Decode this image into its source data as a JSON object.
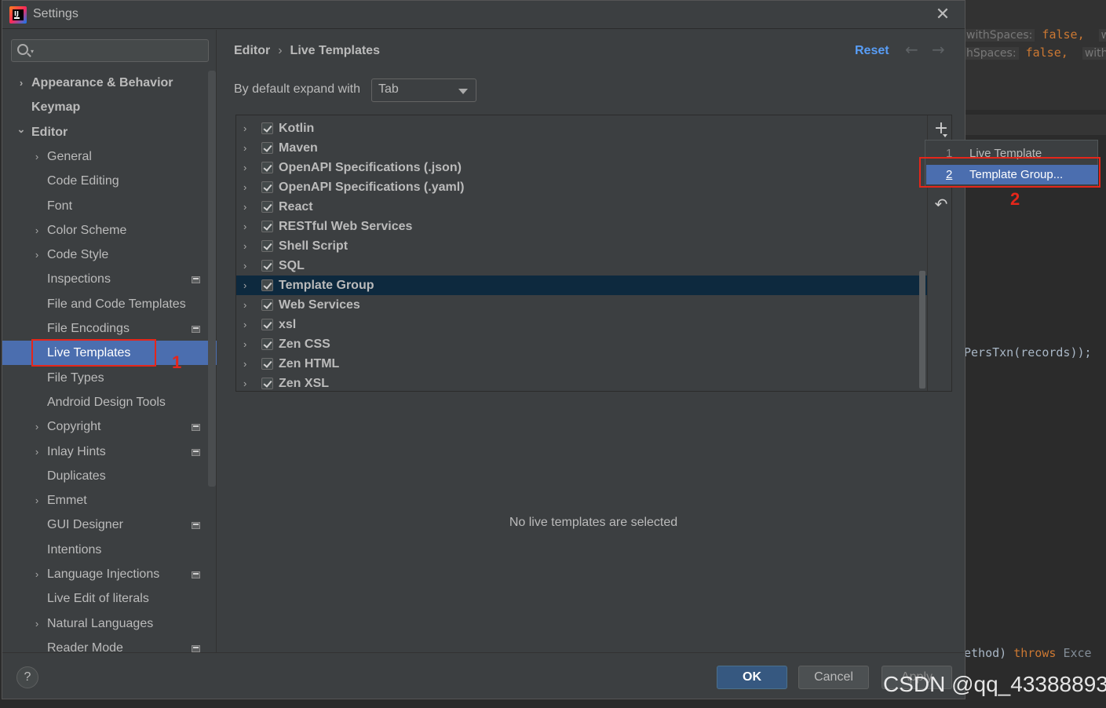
{
  "window": {
    "title": "Settings"
  },
  "search": {
    "placeholder": ""
  },
  "tree": [
    {
      "label": "Appearance & Behavior",
      "level": 0,
      "bold": true,
      "chevron": "right",
      "project": false
    },
    {
      "label": "Keymap",
      "level": 0,
      "bold": true,
      "chevron": "none",
      "project": false
    },
    {
      "label": "Editor",
      "level": 0,
      "bold": true,
      "chevron": "down",
      "project": false
    },
    {
      "label": "General",
      "level": 1,
      "bold": false,
      "chevron": "right",
      "project": false
    },
    {
      "label": "Code Editing",
      "level": 1,
      "bold": false,
      "chevron": "none",
      "project": false
    },
    {
      "label": "Font",
      "level": 1,
      "bold": false,
      "chevron": "none",
      "project": false
    },
    {
      "label": "Color Scheme",
      "level": 1,
      "bold": false,
      "chevron": "right",
      "project": false
    },
    {
      "label": "Code Style",
      "level": 1,
      "bold": false,
      "chevron": "right",
      "project": false
    },
    {
      "label": "Inspections",
      "level": 1,
      "bold": false,
      "chevron": "none",
      "project": true
    },
    {
      "label": "File and Code Templates",
      "level": 1,
      "bold": false,
      "chevron": "none",
      "project": false
    },
    {
      "label": "File Encodings",
      "level": 1,
      "bold": false,
      "chevron": "none",
      "project": true
    },
    {
      "label": "Live Templates",
      "level": 1,
      "bold": false,
      "chevron": "none",
      "project": false,
      "selected": true
    },
    {
      "label": "File Types",
      "level": 1,
      "bold": false,
      "chevron": "none",
      "project": false
    },
    {
      "label": "Android Design Tools",
      "level": 1,
      "bold": false,
      "chevron": "none",
      "project": false
    },
    {
      "label": "Copyright",
      "level": 1,
      "bold": false,
      "chevron": "right",
      "project": true
    },
    {
      "label": "Inlay Hints",
      "level": 1,
      "bold": false,
      "chevron": "right",
      "project": true
    },
    {
      "label": "Duplicates",
      "level": 1,
      "bold": false,
      "chevron": "none",
      "project": false
    },
    {
      "label": "Emmet",
      "level": 1,
      "bold": false,
      "chevron": "right",
      "project": false
    },
    {
      "label": "GUI Designer",
      "level": 1,
      "bold": false,
      "chevron": "none",
      "project": true
    },
    {
      "label": "Intentions",
      "level": 1,
      "bold": false,
      "chevron": "none",
      "project": false
    },
    {
      "label": "Language Injections",
      "level": 1,
      "bold": false,
      "chevron": "right",
      "project": true
    },
    {
      "label": "Live Edit of literals",
      "level": 1,
      "bold": false,
      "chevron": "none",
      "project": false
    },
    {
      "label": "Natural Languages",
      "level": 1,
      "bold": false,
      "chevron": "right",
      "project": false
    },
    {
      "label": "Reader Mode",
      "level": 1,
      "bold": false,
      "chevron": "none",
      "project": true
    }
  ],
  "breadcrumb": {
    "parent": "Editor",
    "current": "Live Templates"
  },
  "header": {
    "reset": "Reset"
  },
  "expand": {
    "label": "By default expand with",
    "value": "Tab"
  },
  "templates": [
    {
      "name": "Kotlin",
      "checked": true
    },
    {
      "name": "Maven",
      "checked": true
    },
    {
      "name": "OpenAPI Specifications (.json)",
      "checked": true
    },
    {
      "name": "OpenAPI Specifications (.yaml)",
      "checked": true
    },
    {
      "name": "React",
      "checked": true
    },
    {
      "name": "RESTful Web Services",
      "checked": true
    },
    {
      "name": "Shell Script",
      "checked": true
    },
    {
      "name": "SQL",
      "checked": true
    },
    {
      "name": "Template Group",
      "checked": true,
      "selected": true
    },
    {
      "name": "Web Services",
      "checked": true
    },
    {
      "name": "xsl",
      "checked": true
    },
    {
      "name": "Zen CSS",
      "checked": true
    },
    {
      "name": "Zen HTML",
      "checked": true
    },
    {
      "name": "Zen XSL",
      "checked": true
    }
  ],
  "empty_message": "No live templates are selected",
  "popup": [
    {
      "num": "1",
      "label": "Live Template"
    },
    {
      "num": "2",
      "label": "Template Group...",
      "selected": true
    }
  ],
  "annotations": {
    "first": "1",
    "second": "2"
  },
  "buttons": {
    "help": "?",
    "ok": "OK",
    "cancel": "Cancel",
    "apply": "Apply"
  },
  "editor_bg": {
    "line1": {
      "hint": "withSpaces:",
      "value": "false,",
      "tail": "w"
    },
    "line2": {
      "hint": "hSpaces:",
      "value": "false,",
      "tail": "with"
    },
    "line3": {
      "code": "PersTxn(records));"
    },
    "line4": {
      "code": "ethod)",
      "keyword": "throws",
      "tail": "Exce"
    }
  },
  "watermark": "CSDN @qq_43388893",
  "colors": {
    "accent": "#4b6eaf",
    "link": "#589df6",
    "annotation": "#e5261a",
    "selected_row": "#0d293e"
  }
}
